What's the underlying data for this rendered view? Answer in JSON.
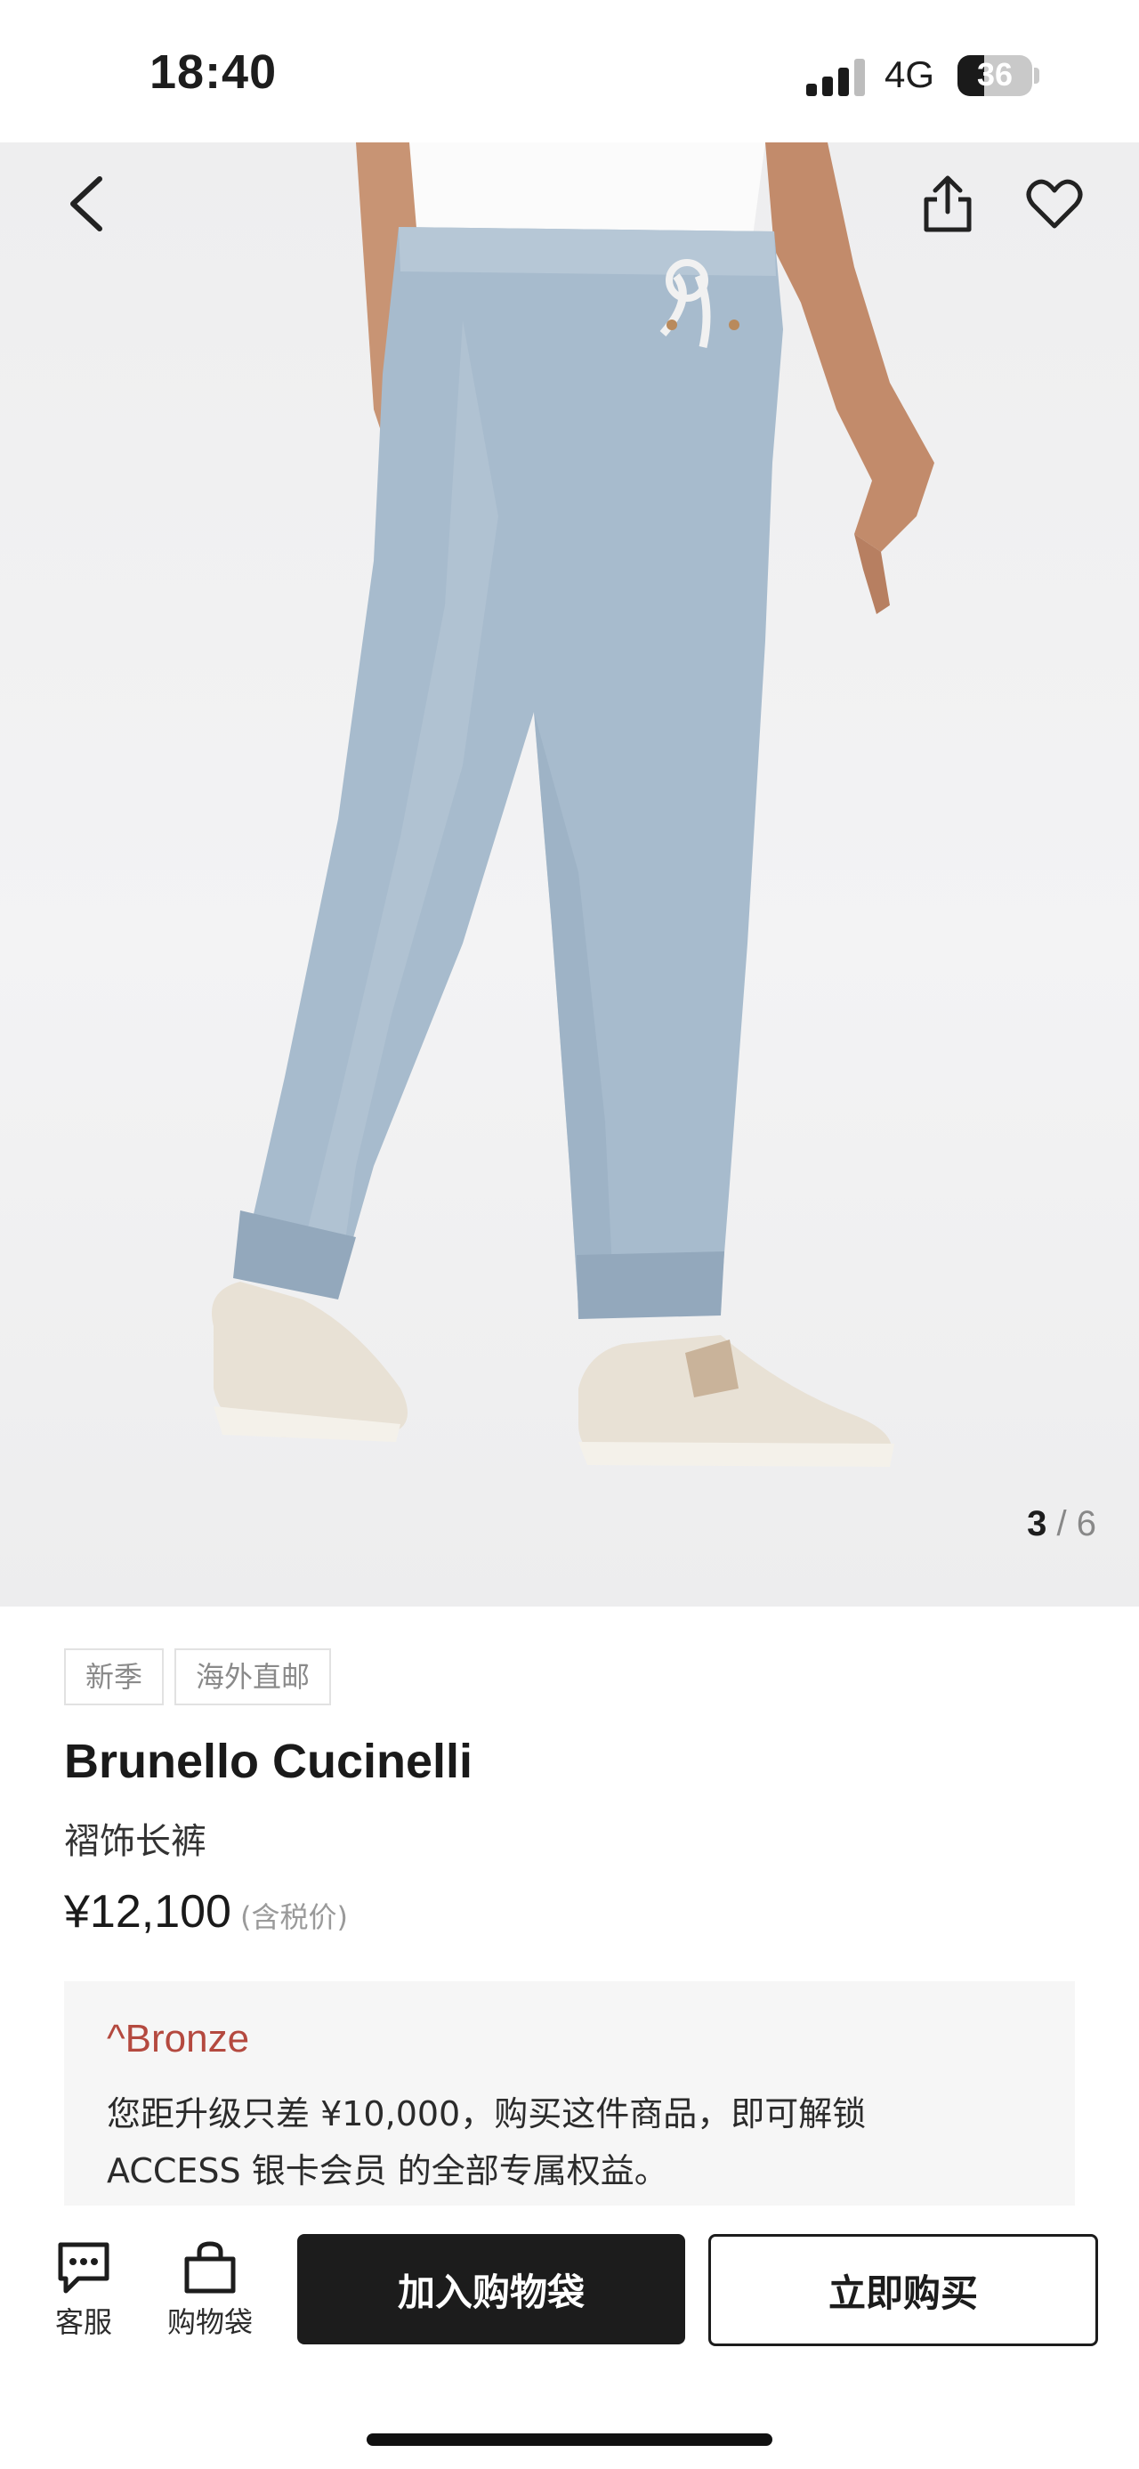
{
  "status_bar": {
    "time": "18:40",
    "network": "4G",
    "battery": "36",
    "battery_level": 0.36
  },
  "gallery": {
    "current": "3",
    "separator": "/",
    "total": "6"
  },
  "tags": [
    "新季",
    "海外直邮"
  ],
  "product": {
    "brand": "Brunello Cucinelli",
    "name": "褶饰长裤",
    "price": "¥12,100",
    "tax_note": "(含税价)"
  },
  "membership": {
    "tier": "^Bronze",
    "line1": "您距升级只差 ¥10,000，购买这件商品，即可解锁",
    "line2": "ACCESS 银卡会员 的全部专属权益。"
  },
  "bottom_bar": {
    "service_label": "客服",
    "bag_label": "购物袋",
    "add_to_bag": "加入购物袋",
    "buy_now": "立即购买"
  },
  "colors": {
    "accent_tier": "#b4493f",
    "primary_button": "#1c1c1c"
  }
}
